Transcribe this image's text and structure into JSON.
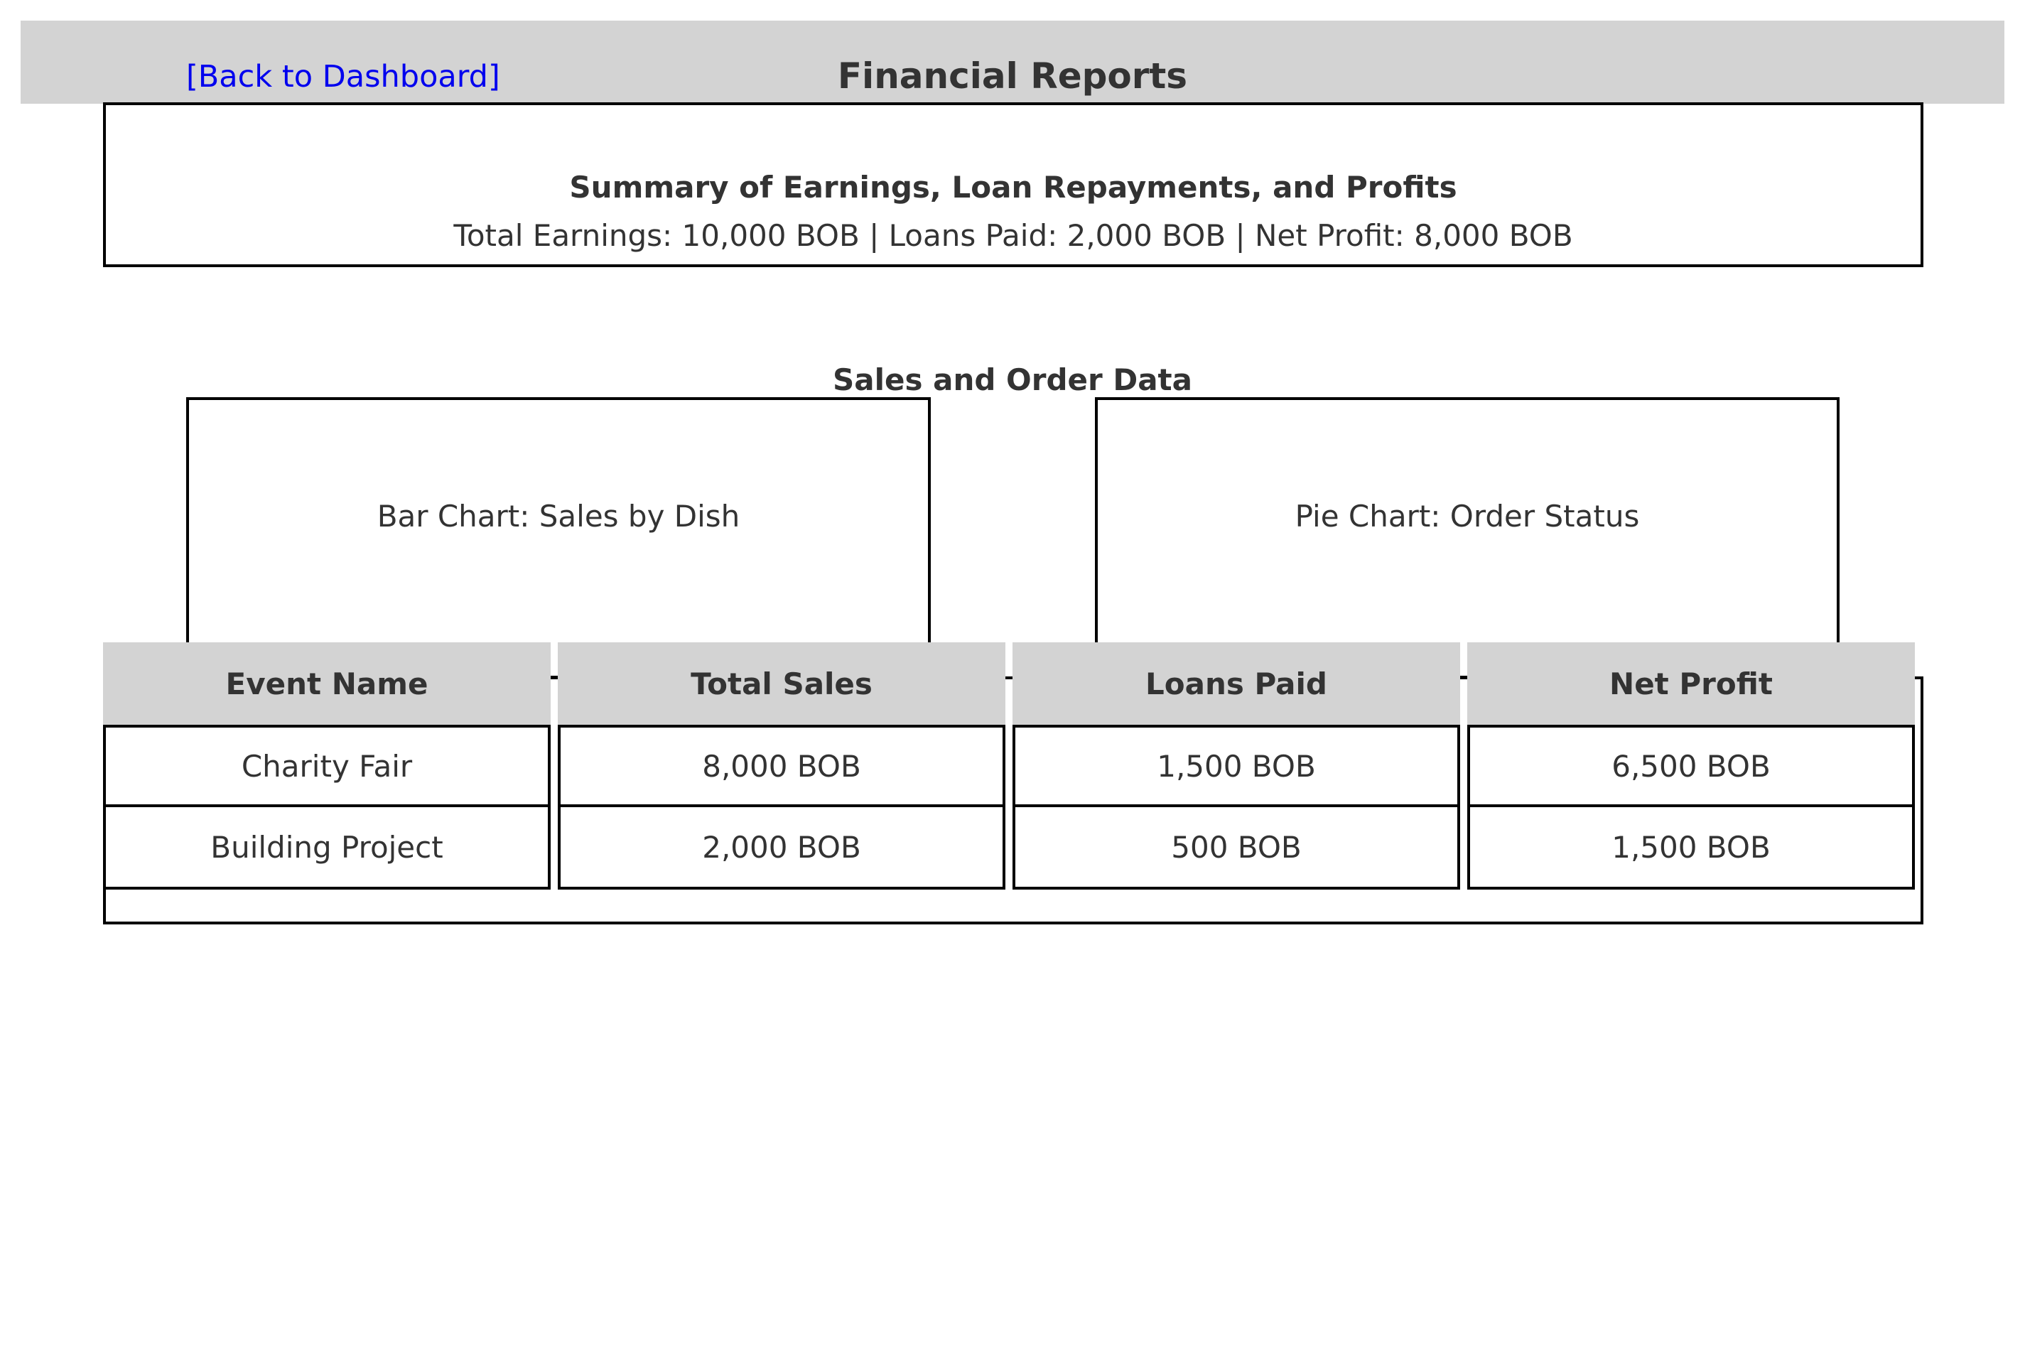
{
  "header": {
    "back_link": "[Back to Dashboard]",
    "title": "Financial Reports"
  },
  "summary": {
    "heading": "Summary of Earnings, Loan Repayments, and Profits",
    "text": "Total Earnings: 10,000 BOB | Loans Paid: 2,000 BOB | Net Profit: 8,000 BOB"
  },
  "sales_section": {
    "title": "Sales and Order Data",
    "bar_chart_placeholder": "Bar Chart: Sales by Dish",
    "pie_chart_placeholder": "Pie Chart: Order Status"
  },
  "table": {
    "columns": [
      "Event Name",
      "Total Sales",
      "Loans Paid",
      "Net Profit"
    ],
    "rows": [
      [
        "Charity Fair",
        "8,000 BOB",
        "1,500 BOB",
        "6,500 BOB"
      ],
      [
        "Building Project",
        "2,000 BOB",
        "500 BOB",
        "1,500 BOB"
      ]
    ]
  },
  "colors": {
    "header_bg": "#d3d3d3",
    "link": "#0000ee",
    "text": "#333333",
    "border": "#000000"
  }
}
